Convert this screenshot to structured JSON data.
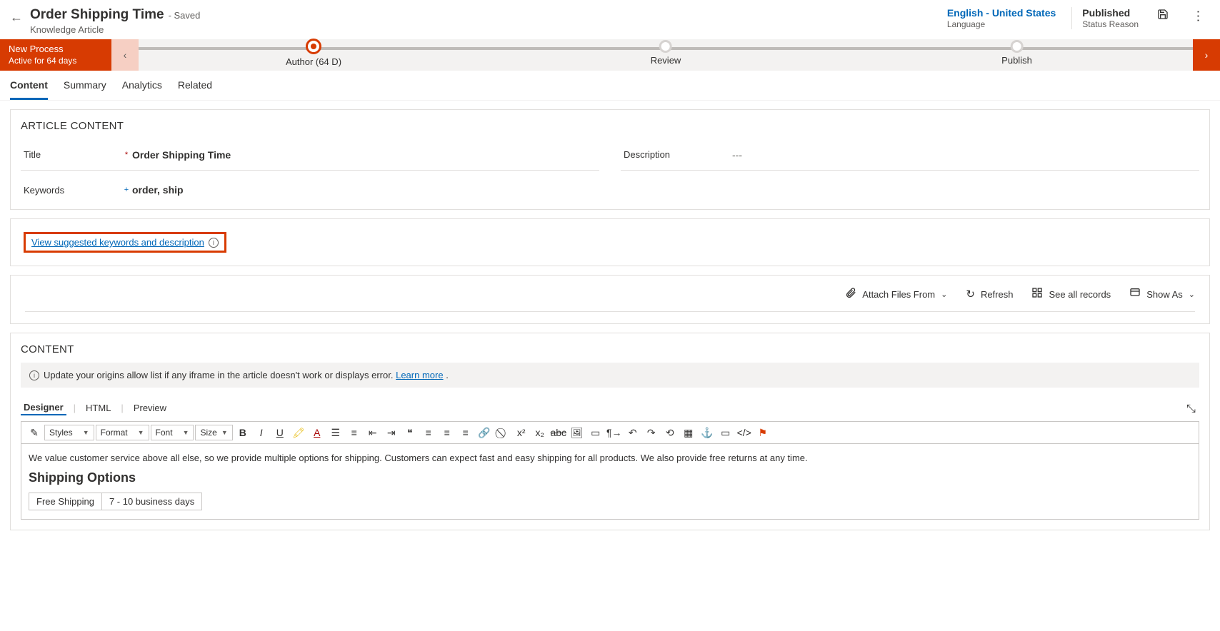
{
  "header": {
    "title": "Order Shipping Time",
    "save_suffix": "- Saved",
    "entity": "Knowledge Article",
    "language_value": "English - United States",
    "language_label": "Language",
    "status_value": "Published",
    "status_label": "Status Reason"
  },
  "process": {
    "name": "New Process",
    "active_for": "Active for 64 days",
    "stages": [
      {
        "label": "Author  (64 D)",
        "active": true
      },
      {
        "label": "Review",
        "active": false
      },
      {
        "label": "Publish",
        "active": false
      }
    ]
  },
  "tabs": [
    "Content",
    "Summary",
    "Analytics",
    "Related"
  ],
  "article": {
    "section_title": "ARTICLE CONTENT",
    "title_label": "Title",
    "title_value": "Order Shipping Time",
    "keywords_label": "Keywords",
    "keywords_value": "order, ship",
    "description_label": "Description",
    "description_value": "---"
  },
  "suggest_link": "View suggested keywords and description",
  "related_toolbar": {
    "attach": "Attach Files From",
    "refresh": "Refresh",
    "see_all": "See all records",
    "show_as": "Show As"
  },
  "content": {
    "section_title": "CONTENT",
    "banner_text": "Update your origins allow list if any iframe in the article doesn't work or displays error.  ",
    "banner_link": "Learn more",
    "banner_tail": " .",
    "editor_tabs": [
      "Designer",
      "HTML",
      "Preview"
    ],
    "rte": {
      "styles": "Styles",
      "format": "Format",
      "font": "Font",
      "size": "Size"
    },
    "body": {
      "intro": "We value customer service above all else, so we provide multiple options for shipping. Customers can expect fast and easy shipping for all products. We also provide free returns at any time.",
      "heading": "Shipping Options",
      "row1a": "Free Shipping",
      "row1b": "7 - 10 business days"
    }
  }
}
